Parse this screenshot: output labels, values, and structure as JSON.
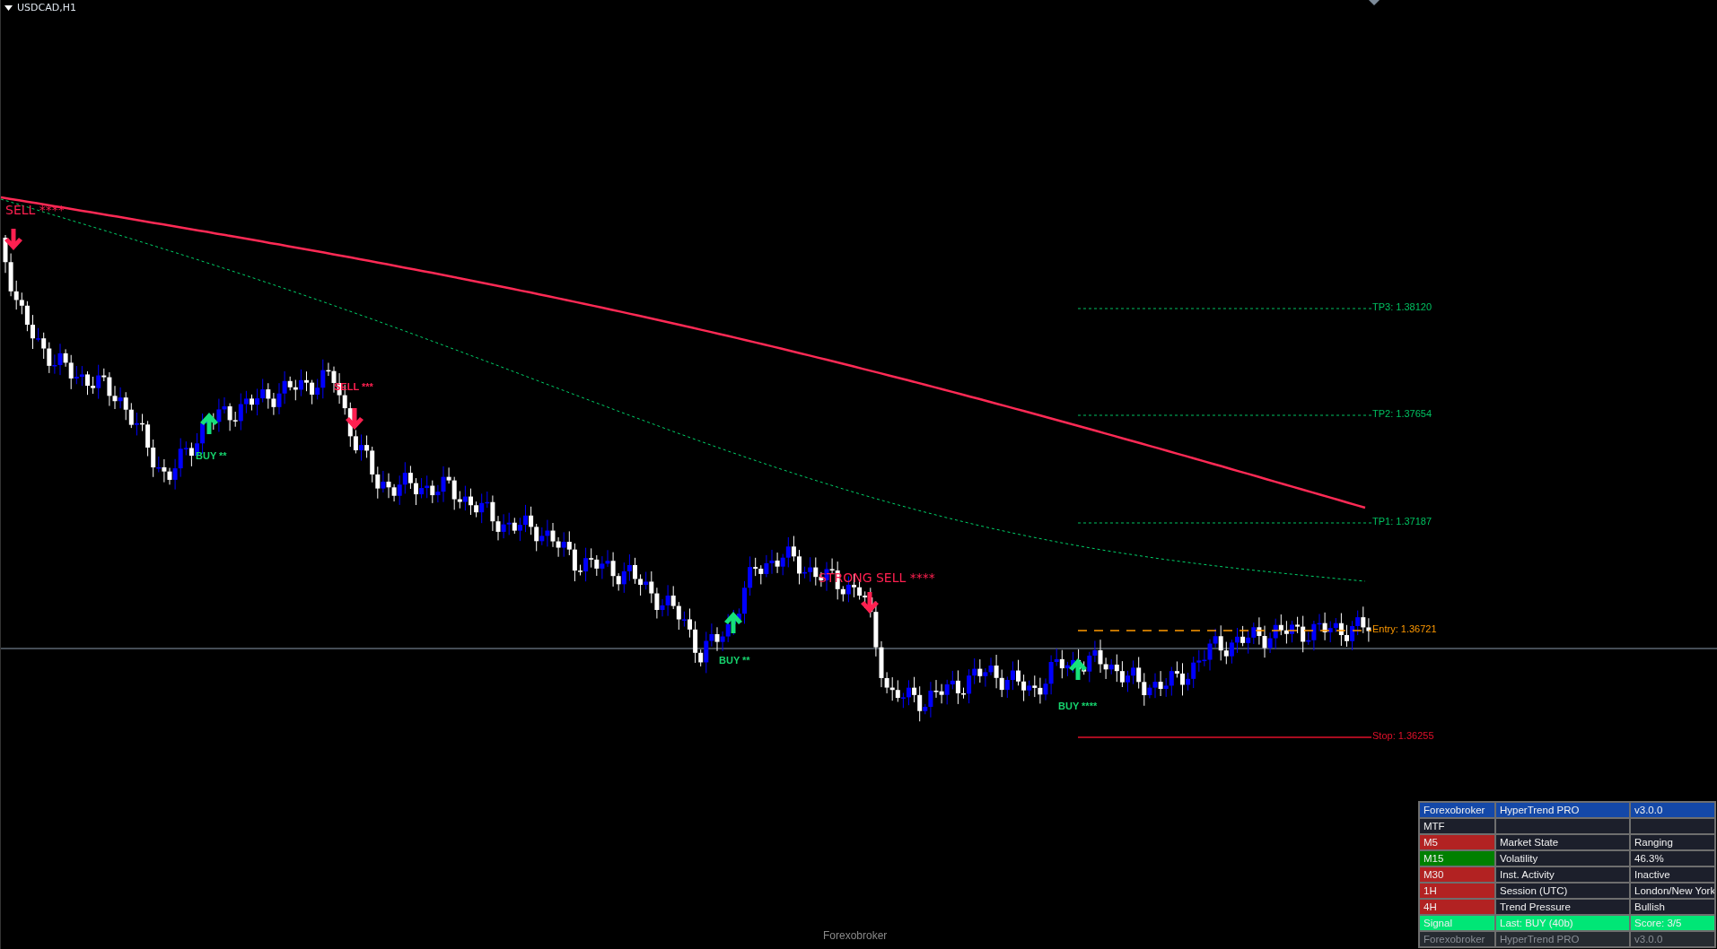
{
  "chart": {
    "symbol": "USDCAD,H1",
    "signals": [
      {
        "kind": "sell",
        "label": "SELL ****"
      },
      {
        "kind": "buy",
        "label": "BUY **"
      },
      {
        "kind": "sell",
        "label": "SELL ***"
      },
      {
        "kind": "buy",
        "label": "BUY **"
      },
      {
        "kind": "sell",
        "label": "STRONG SELL ****"
      },
      {
        "kind": "buy",
        "label": "BUY ****"
      }
    ],
    "levels": [
      {
        "kind": "tp",
        "label": "TP3: 1.38120"
      },
      {
        "kind": "tp",
        "label": "TP2: 1.37654"
      },
      {
        "kind": "tp",
        "label": "TP1: 1.37187"
      },
      {
        "kind": "entry",
        "label": "Entry: 1.36721"
      },
      {
        "kind": "stop",
        "label": "Stop: 1.36255"
      }
    ],
    "footer_label": "Forexobroker"
  },
  "panel": {
    "rows": [
      {
        "kind": "header",
        "cells": [
          "Forexobroker",
          "HyperTrend PRO",
          "v3.0.0"
        ]
      },
      {
        "kind": "mtf",
        "cells": [
          "MTF"
        ]
      },
      {
        "kind": "tf",
        "color": "#b22222",
        "cells": [
          "M5",
          "Market State",
          "Ranging"
        ]
      },
      {
        "kind": "tf",
        "color": "#008000",
        "cells": [
          "M15",
          "Volatility",
          "46.3%"
        ]
      },
      {
        "kind": "tf",
        "color": "#b22222",
        "cells": [
          "M30",
          "Inst. Activity",
          "Inactive"
        ]
      },
      {
        "kind": "tf",
        "color": "#b22222",
        "cells": [
          "1H",
          "Session (UTC)",
          "London/New York"
        ]
      },
      {
        "kind": "tf",
        "color": "#b22222",
        "cells": [
          "4H",
          "Trend Pressure",
          "Bullish"
        ]
      },
      {
        "kind": "signal",
        "cells": [
          "Signal",
          "Last: BUY (40b)",
          "Score: 3/5"
        ]
      },
      {
        "kind": "footer",
        "cells": [
          "Forexobroker",
          "HyperTrend PRO",
          "v3.0.0"
        ]
      }
    ]
  }
}
